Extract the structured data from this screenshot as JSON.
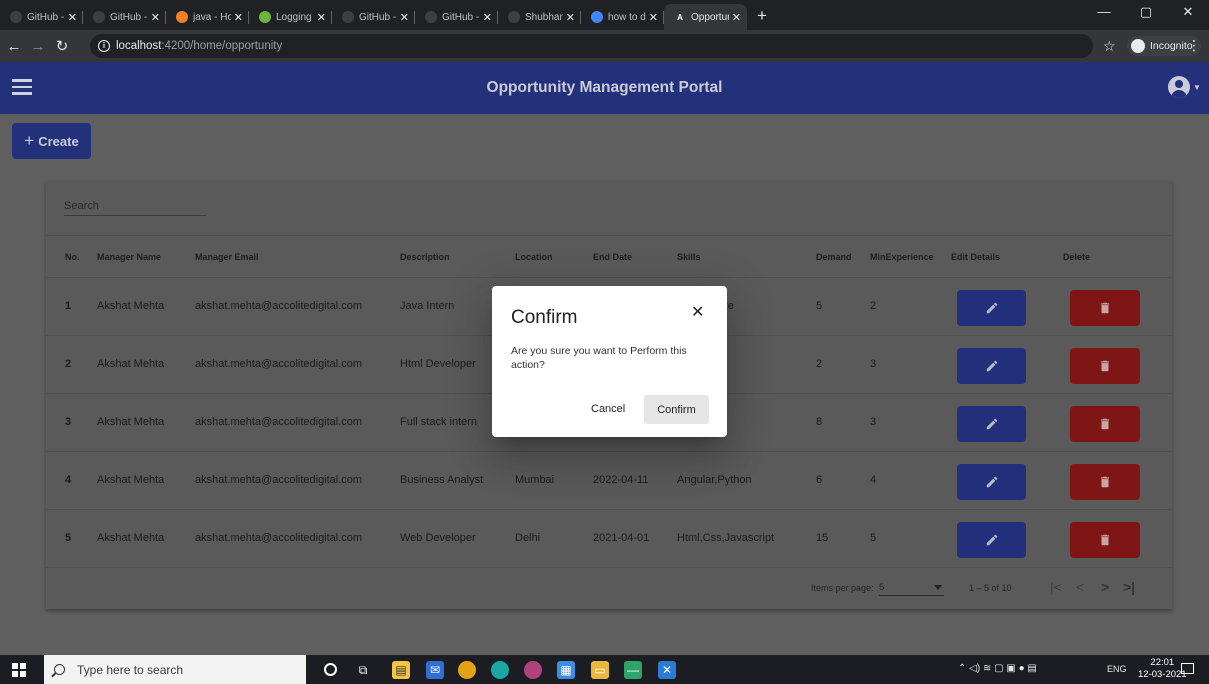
{
  "browser": {
    "tabs": [
      {
        "label": "GitHub - aagar",
        "icon": "github-icon",
        "active": false
      },
      {
        "label": "GitHub - Sanya",
        "icon": "github-icon",
        "active": false
      },
      {
        "label": "java - How do",
        "icon": "stackoverflow-icon",
        "active": false
      },
      {
        "label": "Logging in Spri",
        "icon": "spring-icon",
        "active": false
      },
      {
        "label": "GitHub - Gauro",
        "icon": "github-icon",
        "active": false
      },
      {
        "label": "GitHub - Shubh",
        "icon": "github-icon",
        "active": false
      },
      {
        "label": "ShubhamKuma",
        "icon": "github-icon",
        "active": false
      },
      {
        "label": "how to do logg",
        "icon": "google-icon",
        "active": false
      },
      {
        "label": "OpportunityM",
        "icon": "angular-icon",
        "active": true
      }
    ],
    "tab_close_glyph": "✕",
    "new_tab_glyph": "+",
    "url_host": "localhost",
    "url_path": ":4200/home/opportunity",
    "incognito_label": "Incognito"
  },
  "app": {
    "title": "Opportunity Management Portal",
    "create_label": "Create",
    "search_placeholder": "Search",
    "columns": [
      "No.",
      "Manager Name",
      "Manager Email",
      "Description",
      "Location",
      "End Date",
      "Skills",
      "Demand",
      "MinExperience",
      "Edit Details",
      "Delete"
    ],
    "rows": [
      {
        "no": "1",
        "manager": "Akshat Mehta",
        "email": "akshat.mehta@accolitedigital.com",
        "description": "Java Intern",
        "location": "",
        "end_date": "",
        "skills": "g,Hibernate",
        "demand": "5",
        "min_exp": "2"
      },
      {
        "no": "2",
        "manager": "Akshat Mehta",
        "email": "akshat.mehta@accolitedigital.com",
        "description": "Html Developer",
        "location": "",
        "end_date": "",
        "skills": "",
        "demand": "2",
        "min_exp": "3"
      },
      {
        "no": "3",
        "manager": "Akshat Mehta",
        "email": "akshat.mehta@accolitedigital.com",
        "description": "Full stack intern",
        "location": "",
        "end_date": "",
        "skills": "va,Spring",
        "demand": "8",
        "min_exp": "3"
      },
      {
        "no": "4",
        "manager": "Akshat Mehta",
        "email": "akshat.mehta@accolitedigital.com",
        "description": "Business Analyst",
        "location": "Mumbai",
        "end_date": "2022-04-11",
        "skills": "Angular,Python",
        "demand": "6",
        "min_exp": "4"
      },
      {
        "no": "5",
        "manager": "Akshat Mehta",
        "email": "akshat.mehta@accolitedigital.com",
        "description": "Web Developer",
        "location": "Delhi",
        "end_date": "2021-04-01",
        "skills": "Html,Css,Javascript",
        "demand": "15",
        "min_exp": "5"
      }
    ],
    "paginator": {
      "items_per_page_label": "Items per page:",
      "page_size": "5",
      "range_label": "1 – 5 of 10"
    },
    "colors": {
      "primary": "#3f51b5",
      "warn": "#f44336"
    }
  },
  "dialog": {
    "title": "Confirm",
    "close_glyph": "✕",
    "message": "Are you sure you want to Perform this action?",
    "cancel_label": "Cancel",
    "confirm_label": "Confirm"
  },
  "taskbar": {
    "search_placeholder": "Type here to search",
    "language": "ENG",
    "time": "22:01",
    "date": "12-03-2021"
  }
}
